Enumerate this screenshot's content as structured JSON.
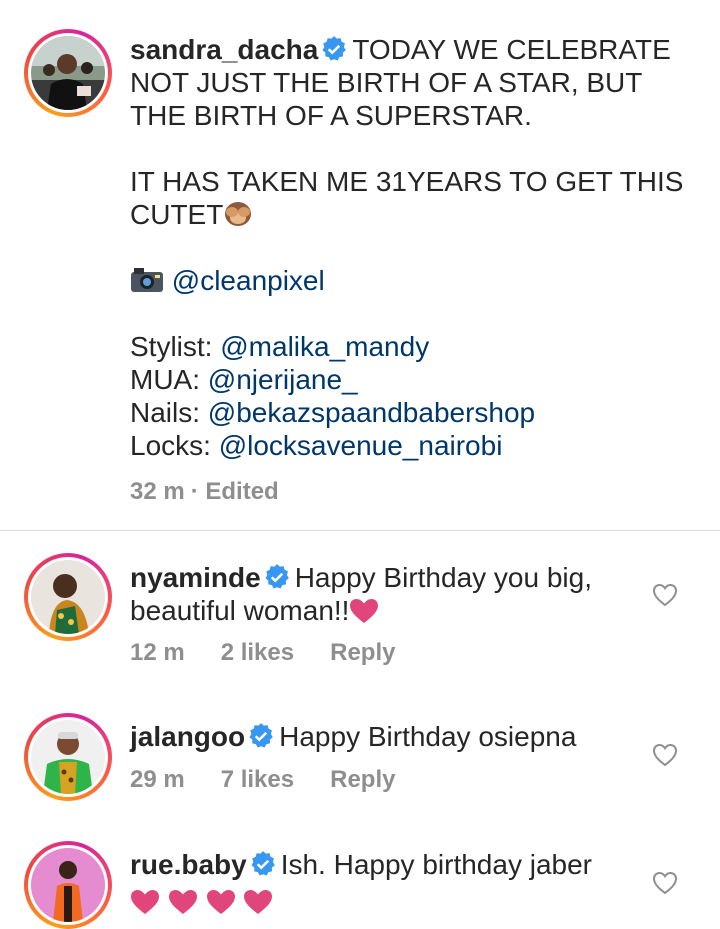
{
  "post": {
    "username": "sandra_dacha",
    "caption_lines": [
      "TODAY WE CELEBRATE",
      "NOT JUST THE BIRTH OF A STAR, BUT",
      "THE BIRTH OF A SUPERSTAR.",
      "",
      "IT HAS TAKEN ME 31YEARS TO GET THIS",
      "CUTET"
    ],
    "photo_credit": "@cleanpixel",
    "credits": [
      {
        "label": "Stylist:",
        "handle": "@malika_mandy"
      },
      {
        "label": "MUA:",
        "handle": "@njerijane_"
      },
      {
        "label": "Nails:",
        "handle": "@bekazspaandbabershop"
      },
      {
        "label": "Locks:",
        "handle": "@locksavenue_nairobi"
      }
    ],
    "time": "32 m",
    "edited": "· Edited"
  },
  "comments": [
    {
      "username": "nyaminde",
      "text_line1": "Happy Birthday you big,",
      "text_line2": "beautiful woman!!",
      "time": "12 m",
      "likes": "2 likes",
      "reply": "Reply"
    },
    {
      "username": "jalangoo",
      "text_line1": "Happy Birthday osiepna",
      "time": "29 m",
      "likes": "7 likes",
      "reply": "Reply"
    },
    {
      "username": "rue.baby",
      "text_line1": "Ish. Happy birthday jaber"
    }
  ],
  "colors": {
    "mention": "#00376b",
    "verified": "#3897f0",
    "heart_emoji": "#e0457b",
    "meta": "#8e8e8e"
  }
}
